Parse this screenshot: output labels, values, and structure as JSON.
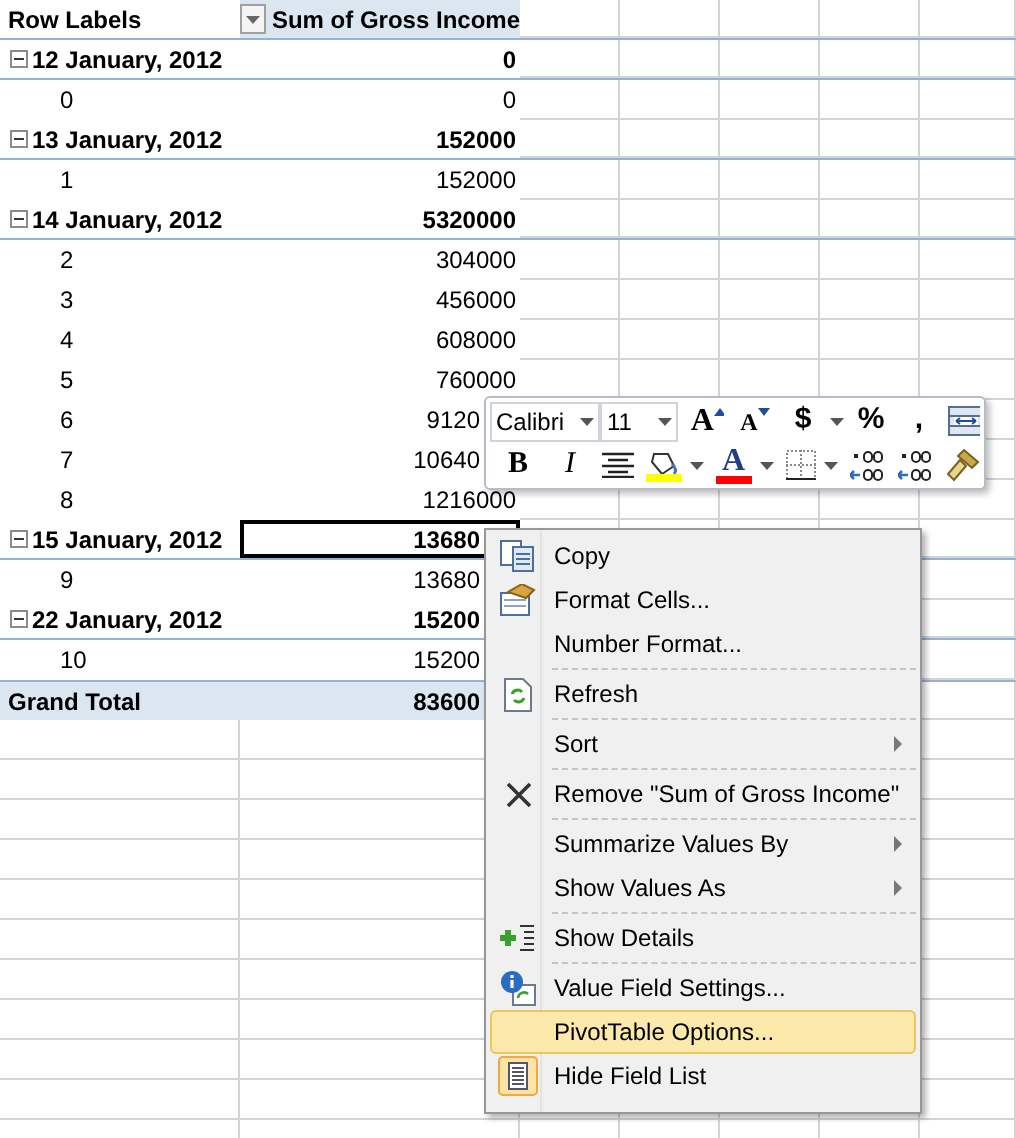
{
  "pivot": {
    "header": {
      "row_labels": "Row Labels",
      "values": "Sum of Gross Income"
    },
    "rows": [
      {
        "kind": "group",
        "label": "12 January, 2012",
        "value": "0",
        "expanded": true
      },
      {
        "kind": "item",
        "label": "0",
        "value": "0"
      },
      {
        "kind": "group",
        "label": "13 January, 2012",
        "value": "152000",
        "expanded": true
      },
      {
        "kind": "item",
        "label": "1",
        "value": "152000"
      },
      {
        "kind": "group",
        "label": "14 January, 2012",
        "value": "5320000",
        "expanded": true
      },
      {
        "kind": "item",
        "label": "2",
        "value": "304000"
      },
      {
        "kind": "item",
        "label": "3",
        "value": "456000"
      },
      {
        "kind": "item",
        "label": "4",
        "value": "608000"
      },
      {
        "kind": "item",
        "label": "5",
        "value": "760000"
      },
      {
        "kind": "item",
        "label": "6",
        "value": "9120",
        "clipped": true
      },
      {
        "kind": "item",
        "label": "7",
        "value": "10640",
        "clipped": true
      },
      {
        "kind": "item",
        "label": "8",
        "value": "1216000"
      },
      {
        "kind": "group",
        "label": "15 January, 2012",
        "value": "13680",
        "expanded": true,
        "clipped": true,
        "selected": true
      },
      {
        "kind": "item",
        "label": "9",
        "value": "13680",
        "clipped": true
      },
      {
        "kind": "group",
        "label": "22 January, 2012",
        "value": "15200",
        "expanded": true,
        "clipped": true
      },
      {
        "kind": "item",
        "label": "10",
        "value": "15200",
        "clipped": true
      },
      {
        "kind": "total",
        "label": "Grand Total",
        "value": "83600",
        "clipped": true
      }
    ]
  },
  "mini_toolbar": {
    "font": "Calibri",
    "size": "11",
    "row1": [
      {
        "kind": "grow",
        "glyph": "A"
      },
      {
        "kind": "shrink",
        "glyph": "A"
      },
      {
        "kind": "text",
        "glyph": "$",
        "dropdown": true
      },
      {
        "kind": "text",
        "glyph": "%"
      },
      {
        "kind": "text",
        "glyph": ","
      },
      {
        "kind": "merge"
      }
    ],
    "row2": [
      {
        "kind": "bold",
        "glyph": "B"
      },
      {
        "kind": "italic",
        "glyph": "I"
      },
      {
        "kind": "center"
      },
      {
        "kind": "fill",
        "dropdown": true
      },
      {
        "kind": "fontcolor",
        "glyph": "A",
        "dropdown": true
      },
      {
        "kind": "borders",
        "dropdown": true
      },
      {
        "kind": "incdec"
      },
      {
        "kind": "decdec"
      },
      {
        "kind": "painter"
      }
    ]
  },
  "context_menu": [
    {
      "label": "Copy",
      "kind": "copy",
      "selected": false
    },
    {
      "label": "Format Cells...",
      "kind": "format",
      "selected": false
    },
    {
      "label": "Number Format...",
      "selected": false,
      "separator_after": true
    },
    {
      "label": "Refresh",
      "kind": "refresh",
      "selected": false,
      "separator_after": true
    },
    {
      "label": "Sort",
      "submenu": true,
      "selected": false,
      "separator_after": true
    },
    {
      "label": "Remove \"Sum of Gross Income\"",
      "kind": "remove",
      "selected": false,
      "separator_after": true
    },
    {
      "label": "Summarize Values By",
      "submenu": true,
      "selected": false
    },
    {
      "label": "Show Values As",
      "submenu": true,
      "selected": false,
      "separator_after": true
    },
    {
      "label": "Show Details",
      "kind": "details",
      "selected": false,
      "separator_after": true
    },
    {
      "label": "Value Field Settings...",
      "kind": "settings",
      "selected": false
    },
    {
      "label": "PivotTable Options...",
      "selected": true
    },
    {
      "label": "Hide Field List",
      "kind": "fieldlist",
      "selected": false
    }
  ]
}
